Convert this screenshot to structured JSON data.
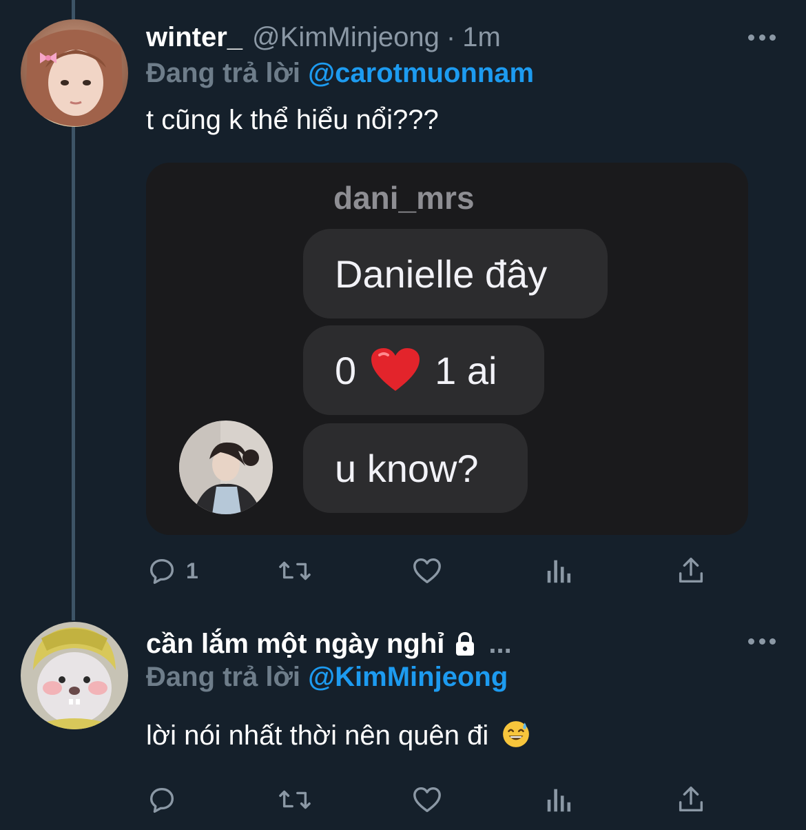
{
  "tweets": [
    {
      "name": "winter_",
      "handle": "@KimMinjeong",
      "separator": "·",
      "time": "1m",
      "reply_prefix": "Đang trả lời",
      "reply_to": "@carotmuonnam",
      "text": "t cũng k thể hiểu nổi???",
      "actions": {
        "reply_count": "1"
      },
      "media": {
        "sender": "dani_mrs",
        "messages": [
          {
            "text": "Danielle đây"
          },
          {
            "text_before": "0",
            "icon": "heart-icon",
            "text_after": "1 ai"
          },
          {
            "text": "u know?"
          }
        ]
      }
    },
    {
      "name": "cần lắm một ngày nghỉ",
      "name_ellipsis": "...",
      "icon": "lock-icon",
      "reply_prefix": "Đang trả lời",
      "reply_to": "@KimMinjeong",
      "text": "lời nói nhất thời nên quên đi",
      "emoji": "sweat-smile-icon",
      "actions": {
        "reply_count": ""
      }
    }
  ],
  "colors": {
    "background": "#15202b",
    "accent": "#1d9bf0",
    "muted": "#8b98a5",
    "bubble": "#2c2c2e",
    "media_bg": "#1a1a1c"
  }
}
